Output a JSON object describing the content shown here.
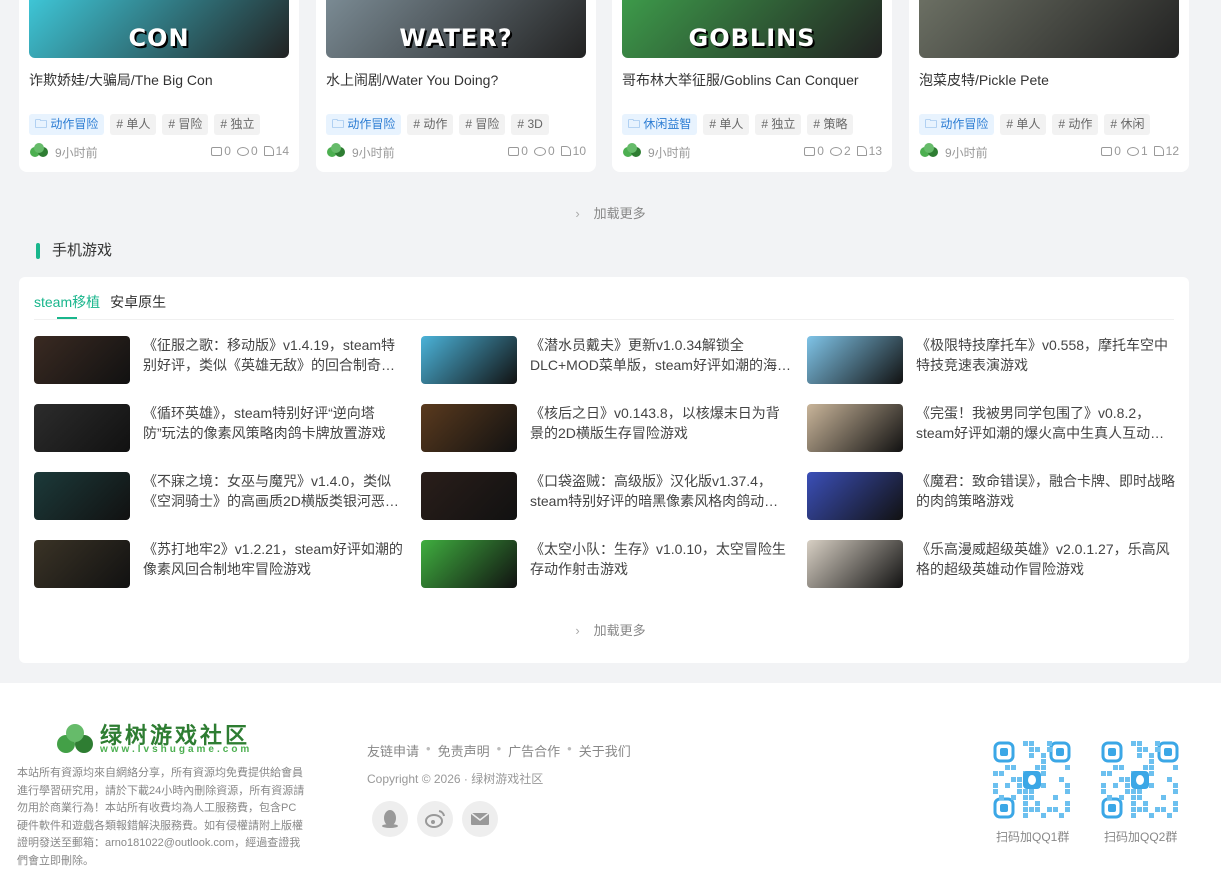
{
  "cards": [
    {
      "title": "诈欺娇娃/大骗局/The Big Con",
      "thumb_text": "CON",
      "tags": [
        "动作冒险",
        "单人",
        "冒险",
        "独立"
      ],
      "time": "9小时前",
      "comments": "0",
      "views": "0",
      "likes": "14",
      "bg": "#3ec5d6"
    },
    {
      "title": "水上闹剧/Water You Doing?",
      "thumb_text": "WATER?",
      "tags": [
        "动作冒险",
        "动作",
        "冒险",
        "3D"
      ],
      "time": "9小时前",
      "comments": "0",
      "views": "0",
      "likes": "10",
      "bg": "#7a8a93"
    },
    {
      "title": "哥布林大举征服/Goblins Can Conquer",
      "thumb_text": "GOBLINS",
      "tags": [
        "休闲益智",
        "单人",
        "独立",
        "策略"
      ],
      "time": "9小时前",
      "comments": "0",
      "views": "2",
      "likes": "13",
      "bg": "#3d9a4a"
    },
    {
      "title": "泡菜皮特/Pickle Pete",
      "thumb_text": "",
      "tags": [
        "动作冒险",
        "单人",
        "动作",
        "休闲"
      ],
      "time": "9小时前",
      "comments": "0",
      "views": "1",
      "likes": "12",
      "bg": "#6b6f63"
    }
  ],
  "load_more": "加载更多",
  "section_title": "手机游戏",
  "tabs": [
    "steam移植",
    "安卓原生"
  ],
  "games": [
    {
      "text": "《征服之歌：移动版》v1.4.19，steam特别好评，类似《英雄无敌》的回合制奇幻策略游戏",
      "bg": "#3a2a22"
    },
    {
      "text": "《潜水员戴夫》更新v1.0.34解锁全DLC+MOD菜单版，steam好评如潮的海洋探险游戏",
      "bg": "#4bb3d9"
    },
    {
      "text": "《极限特技摩托车》v0.558，摩托车空中特技竞速表演游戏",
      "bg": "#7fc4e8"
    },
    {
      "text": "《循环英雄》，steam特别好评“逆向塔防”玩法的像素风策略肉鸽卡牌放置游戏",
      "bg": "#2c2c2c"
    },
    {
      "text": "《核后之日》v0.143.8，以核爆末日为背景的2D横版生存冒险游戏",
      "bg": "#5a3a1e"
    },
    {
      "text": "《完蛋！我被男同学包围了》v0.8.2，steam好评如潮的爆火高中生真人互动恋爱游戏",
      "bg": "#c9b59a"
    },
    {
      "text": "《不寐之境：女巫与魔咒》v1.4.0，类似《空洞骑士》的高画质2D横版类银河恶魔城游戏",
      "bg": "#1c3a3a"
    },
    {
      "text": "《口袋盗贼：高级版》汉化版v1.37.4，steam特别好评的暗黑像素风格肉鸽动作冒险游戏",
      "bg": "#2a1e1a"
    },
    {
      "text": "《魔君：致命错误》，融合卡牌、即时战略的肉鸽策略游戏",
      "bg": "#3b4fb8"
    },
    {
      "text": "《苏打地牢2》v1.2.21，steam好评如潮的像素风回合制地牢冒险游戏",
      "bg": "#3a3326"
    },
    {
      "text": "《太空小队：生存》v1.0.10，太空冒险生存动作射击游戏",
      "bg": "#3fae3f"
    },
    {
      "text": "《乐高漫威超级英雄》v2.0.1.27，乐高风格的超级英雄动作冒险游戏",
      "bg": "#d8d0c4"
    }
  ],
  "footer": {
    "logo_title": "绿树游戏社区",
    "logo_sub": "www.lvshugame.com",
    "desc": "本站所有資源均來自網絡分享，所有資源均免費提供給會員進行學習研究用，請於下載24小時內刪除資源，所有資源請勿用於商業行為！本站所有收費均為人工服務費，包含PC硬件軟件和遊戲各類報錯解決服務費。如有侵權請附上版權證明發送至郵箱：arno181022@outlook.com，經過查證我們會立即刪除。",
    "links": [
      "友链申请",
      "免责声明",
      "广告合作",
      "关于我们"
    ],
    "copyright": "Copyright © 2026 · 绿树游戏社区",
    "qr1_label": "扫码加QQ1群",
    "qr2_label": "扫码加QQ2群"
  },
  "colors": {
    "accent": "#19b68c",
    "tag_cat": "#2b7cd3"
  }
}
